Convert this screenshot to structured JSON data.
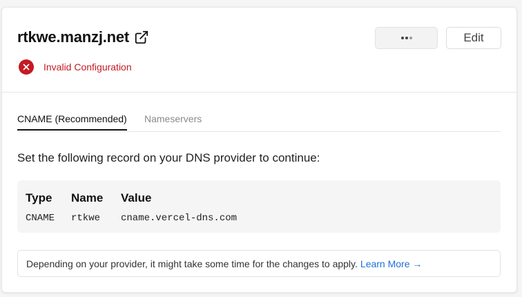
{
  "domain": {
    "name": "rtkwe.manzj.net",
    "status_text": "Invalid Configuration",
    "colors": {
      "error": "#c41a24",
      "link": "#1b6fd8"
    }
  },
  "actions": {
    "edit_label": "Edit"
  },
  "tabs": [
    {
      "label": "CNAME (Recommended)",
      "active": true
    },
    {
      "label": "Nameservers",
      "active": false
    }
  ],
  "instruction": "Set the following record on your DNS provider to continue:",
  "record": {
    "headers": [
      "Type",
      "Name",
      "Value"
    ],
    "values": [
      "CNAME",
      "rtkwe",
      "cname.vercel-dns.com"
    ]
  },
  "note": {
    "text": "Depending on your provider, it might take some time for the changes to apply.",
    "link_label": "Learn More →"
  }
}
